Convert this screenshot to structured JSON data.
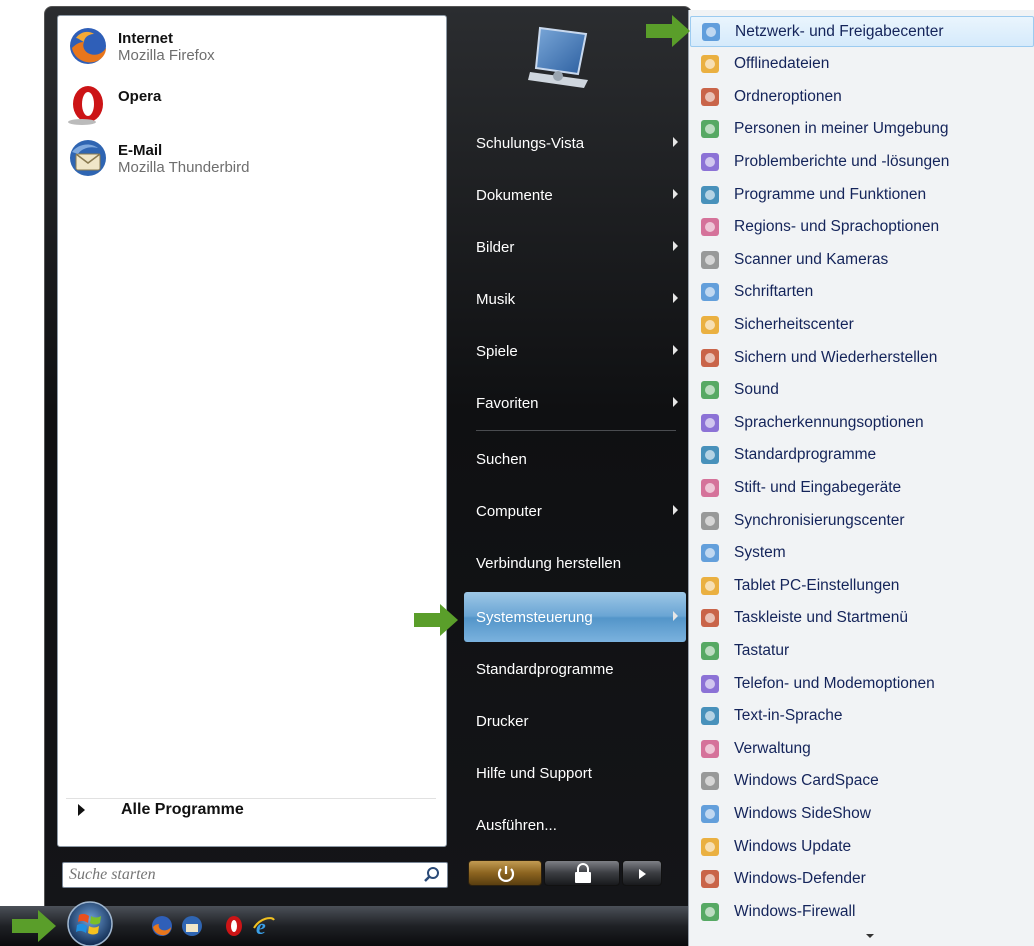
{
  "pinned": [
    {
      "title": "Internet",
      "subtitle": "Mozilla Firefox",
      "icon": "firefox-icon"
    },
    {
      "title": "Opera",
      "subtitle": "",
      "icon": "opera-icon"
    },
    {
      "title": "E-Mail",
      "subtitle": "Mozilla Thunderbird",
      "icon": "thunderbird-icon"
    }
  ],
  "all_programs": "Alle Programme",
  "search": {
    "placeholder": "Suche starten"
  },
  "right_items": [
    {
      "label": "Schulungs-Vista",
      "submenu": true
    },
    {
      "label": "Dokumente",
      "submenu": true
    },
    {
      "label": "Bilder",
      "submenu": true
    },
    {
      "label": "Musik",
      "submenu": true
    },
    {
      "label": "Spiele",
      "submenu": true
    },
    {
      "label": "Favoriten",
      "submenu": true
    },
    {
      "label": "Suchen",
      "submenu": false
    },
    {
      "label": "Computer",
      "submenu": true
    },
    {
      "label": "Verbindung herstellen",
      "submenu": false
    },
    {
      "label": "Systemsteuerung",
      "submenu": true,
      "selected": true
    },
    {
      "label": "Standardprogramme",
      "submenu": false
    },
    {
      "label": "Drucker",
      "submenu": false
    },
    {
      "label": "Hilfe und Support",
      "submenu": false
    },
    {
      "label": "Ausführen...",
      "submenu": false
    }
  ],
  "control_panel_items": [
    {
      "label": "Netzwerk- und Freigabecenter",
      "icon": "network-icon",
      "highlighted": true
    },
    {
      "label": "Offlinedateien",
      "icon": "offline-files-icon"
    },
    {
      "label": "Ordneroptionen",
      "icon": "folder-options-icon"
    },
    {
      "label": "Personen in meiner Umgebung",
      "icon": "people-near-me-icon"
    },
    {
      "label": "Problemberichte und -lösungen",
      "icon": "problem-reports-icon"
    },
    {
      "label": "Programme und Funktionen",
      "icon": "programs-features-icon"
    },
    {
      "label": "Regions- und Sprachoptionen",
      "icon": "regional-options-icon"
    },
    {
      "label": "Scanner und Kameras",
      "icon": "scanner-icon"
    },
    {
      "label": "Schriftarten",
      "icon": "fonts-icon"
    },
    {
      "label": "Sicherheitscenter",
      "icon": "security-center-icon"
    },
    {
      "label": "Sichern und Wiederherstellen",
      "icon": "backup-icon"
    },
    {
      "label": "Sound",
      "icon": "sound-icon"
    },
    {
      "label": "Spracherkennungsoptionen",
      "icon": "speech-recognition-icon"
    },
    {
      "label": "Standardprogramme",
      "icon": "default-programs-icon"
    },
    {
      "label": "Stift- und Eingabegeräte",
      "icon": "pen-input-icon"
    },
    {
      "label": "Synchronisierungscenter",
      "icon": "sync-center-icon"
    },
    {
      "label": "System",
      "icon": "system-icon"
    },
    {
      "label": "Tablet PC-Einstellungen",
      "icon": "tablet-pc-icon"
    },
    {
      "label": "Taskleiste und Startmenü",
      "icon": "taskbar-icon"
    },
    {
      "label": "Tastatur",
      "icon": "keyboard-icon"
    },
    {
      "label": "Telefon- und Modemoptionen",
      "icon": "phone-modem-icon"
    },
    {
      "label": "Text-in-Sprache",
      "icon": "text-to-speech-icon"
    },
    {
      "label": "Verwaltung",
      "icon": "admin-tools-icon"
    },
    {
      "label": "Windows CardSpace",
      "icon": "cardspace-icon"
    },
    {
      "label": "Windows SideShow",
      "icon": "sideshow-icon"
    },
    {
      "label": "Windows Update",
      "icon": "windows-update-icon"
    },
    {
      "label": "Windows-Defender",
      "icon": "defender-icon"
    },
    {
      "label": "Windows-Firewall",
      "icon": "firewall-icon"
    }
  ],
  "taskbar_icons": [
    "firefox-icon",
    "thunderbird-icon",
    "opera-icon",
    "internet-explorer-icon"
  ],
  "colors": {
    "accent_green": "#5a9e2a",
    "selected_blue": "#6aa5d4",
    "submenu_text": "#14245a"
  }
}
